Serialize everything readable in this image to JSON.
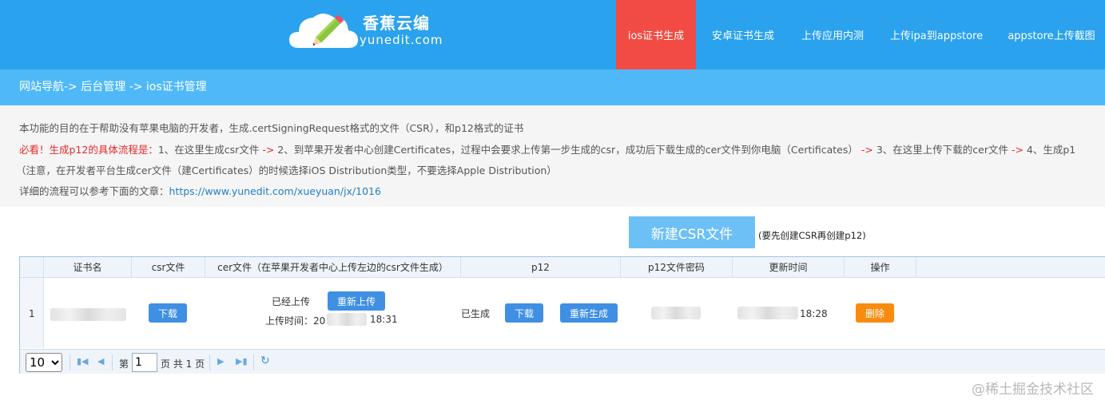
{
  "header": {
    "logo_title": "香蕉云编",
    "logo_sub": "yunedit.com",
    "nav": [
      {
        "label": "ios证书生成",
        "active": true
      },
      {
        "label": "安卓证书生成",
        "active": false
      },
      {
        "label": "上传应用内测",
        "active": false
      },
      {
        "label": "上传ipa到appstore",
        "active": false
      },
      {
        "label": "appstore上传截图",
        "active": false
      }
    ]
  },
  "breadcrumb": "网站导航-> 后台管理 -> ios证书管理",
  "info": {
    "line1": "本功能的目的在于帮助没有苹果电脑的开发者，生成.certSigningRequest格式的文件（CSR），和p12格式的证书",
    "line2_prefix": "必看！生成p12的具体流程是：",
    "line2_step1": "1、在这里生成csr文件",
    "arrow": "->",
    "line2_step2": "2、到苹果开发者中心创建Certificates，过程中会要求上传第一步生成的csr，成功后下载生成的cer文件到你电脑（Certificates）",
    "line2_step3": "3、在这里上传下载的cer文件",
    "line2_step4": "4、生成p1",
    "line3": "（注意，在开发者平台生成cer文件（建Certificates）的时候选择iOS Distribution类型，不要选择Apple Distribution）",
    "line4_prefix": "详细的流程可以参考下面的文章：",
    "line4_link": "https://www.yunedit.com/xueyuan/jx/1016"
  },
  "new_csr": {
    "label": "新建CSR文件",
    "note": "(要先创建CSR再创建p12)"
  },
  "table": {
    "columns": [
      "证书名",
      "csr文件",
      "cer文件（在苹果开发者中心上传左边的csr文件生成）",
      "p12",
      "p12文件密码",
      "更新时间",
      "操作"
    ],
    "row": {
      "num": "1",
      "csr_download": "下载",
      "cer_status": "已经上传",
      "cer_reupload": "重新上传",
      "cer_upload_time_label": "上传时间：",
      "cer_upload_time_prefix": "20",
      "cer_upload_time_suffix": "18:31",
      "p12_status": "已生成",
      "p12_download": "下载",
      "p12_regenerate": "重新生成",
      "update_time_suffix": "18:28",
      "delete": "删除"
    }
  },
  "pager": {
    "page_size": "10",
    "page_label": "第",
    "page_value": "1",
    "total_label": "页 共 1 页"
  },
  "watermark": "@稀土掘金技术社区",
  "colors": {
    "header_bg": "#2aa2ee",
    "nav_active": "#f24b43",
    "breadcrumb_bg": "#4fb9f8",
    "button_blue": "#3f8fe3",
    "button_orange": "#f98b10"
  }
}
